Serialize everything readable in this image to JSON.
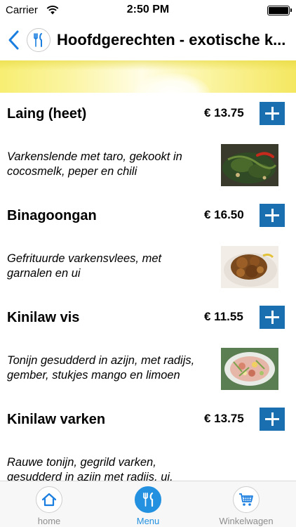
{
  "status_bar": {
    "carrier": "Carrier",
    "time": "2:50 PM",
    "battery_level": 1.0
  },
  "nav": {
    "title": "Hoofdgerechten - exotische k...",
    "back_icon": "chevron-left-icon",
    "menu_icon": "fork-knife-icon",
    "accent_color": "#1a7ee0"
  },
  "items": [
    {
      "name": "Laing (heet)",
      "price": "€ 13.75",
      "description": "Varkenslende met taro, gekookt in cocosmelk, peper en chili"
    },
    {
      "name": "Binagoongan",
      "price": "€ 16.50",
      "description": "Gefrituurde varkensvlees, met garnalen en ui"
    },
    {
      "name": "Kinilaw vis",
      "price": "€ 11.55",
      "description": "Tonijn gesudderd in azijn, met radijs, gember, stukjes mango en limoen"
    },
    {
      "name": "Kinilaw varken",
      "price": "€ 13.75",
      "description": "Rauwe tonijn, gegrild varken, gesudderd in azijn met radijs, ui,"
    }
  ],
  "add_button_color": "#1a6fb0",
  "tabs": [
    {
      "label": "home",
      "icon": "home-icon",
      "active": false
    },
    {
      "label": "Menu",
      "icon": "fork-knife-icon",
      "active": true
    },
    {
      "label": "Winkelwagen",
      "icon": "cart-icon",
      "active": false
    }
  ],
  "tab_active_color": "#2391e0"
}
